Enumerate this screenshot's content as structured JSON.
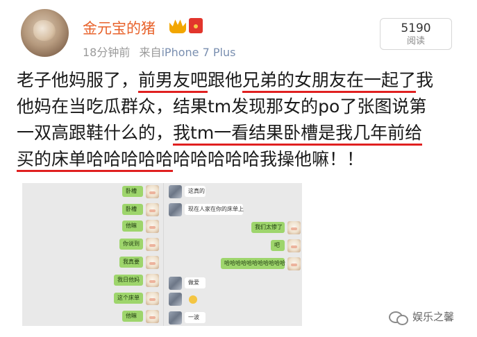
{
  "header": {
    "username": "金元宝的猪",
    "time": "18分钟前",
    "source_prefix": "来自",
    "source": "iPhone 7 Plus",
    "read_count": "5190",
    "read_label": "阅读",
    "badge_crown_icon": "crown-icon",
    "badge_red_icon": "red-envelope-icon"
  },
  "post": {
    "line1": [
      {
        "text": "老子他妈服了，",
        "u": false
      },
      {
        "text": "前男友吧",
        "u": true
      },
      {
        "text": "跟他",
        "u": false
      },
      {
        "text": "兄弟的女朋友在一起了",
        "u": true
      },
      {
        "text": "我",
        "u": false
      }
    ],
    "line2": "他妈在当吃瓜群众，结果tm发现那女的po了张图说第",
    "line3": [
      {
        "text": "一双高跟鞋什么的，",
        "u": false
      },
      {
        "text": "我tm一看结果卧槽是我几年前给",
        "u": true
      }
    ],
    "line4": [
      {
        "text": "买的床单哈哈哈哈哈",
        "u": true
      },
      {
        "text": "哈哈哈哈哈我操他嘛！！",
        "u": false
      }
    ]
  },
  "screenshot": {
    "left": [
      "卧槽",
      "卧槽",
      "他嘛",
      "你说到",
      "我真要",
      "我日他妈",
      "这个床单",
      "他嘛"
    ],
    "right": [
      {
        "text": "这真的",
        "side": "w"
      },
      {
        "text": "现在人家在你的床单上",
        "side": "w"
      },
      {
        "text": "我们太惨了",
        "side": "g"
      },
      {
        "text": "吧",
        "side": "g"
      },
      {
        "text": "哈哈哈哈哈哈哈哈哈哈哈",
        "side": "g"
      },
      {
        "text": "做爱",
        "side": "w"
      },
      {
        "text": "一波",
        "side": "w"
      }
    ]
  },
  "watermark": {
    "icon": "wechat-icon",
    "text": "娱乐之馨"
  },
  "colors": {
    "username": "#e8622b",
    "underline": "#e02020",
    "green_bubble": "#9ed56c",
    "source_link": "#7a8fb0"
  }
}
